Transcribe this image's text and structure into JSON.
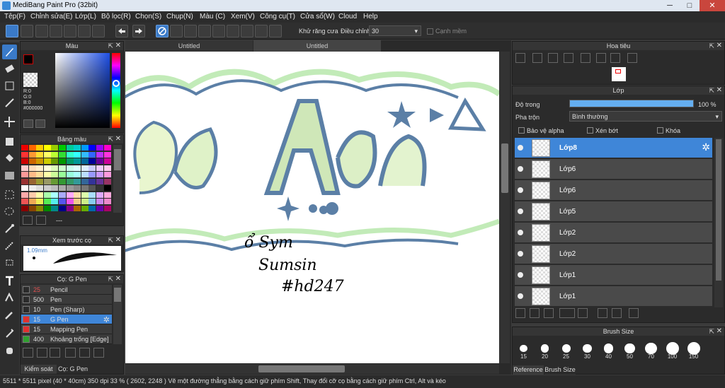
{
  "window": {
    "title": "MediBang Paint Pro (32bit)"
  },
  "menu": [
    "Tệp(F)",
    "Chỉnh sửa(E)",
    "Lớp(L)",
    "Bộ lọc(R)",
    "Chọn(S)",
    "Chụp(N)",
    "Màu (C)",
    "Xem(V)",
    "Công cụ(T)",
    "Cửa sổ(W)",
    "Cloud",
    "Help"
  ],
  "toolbar": {
    "antialias_label": "Khử răng cưa",
    "adjust_label": "Điều chỉnh",
    "adjust_value": "30",
    "edge_label": "Cạnh mềm"
  },
  "tabs": [
    "Untitled",
    "Untitled"
  ],
  "color_panel": {
    "title": "Màu",
    "r": "R:0",
    "g": "G:0",
    "b": "B:0",
    "hex": "#000000"
  },
  "palette_panel": {
    "title": "Bảng màu",
    "dashes": "---"
  },
  "preview_panel": {
    "title": "Xem trước cọ",
    "size": "1.09mm"
  },
  "brush_panel": {
    "title": "Cọ: G Pen",
    "items": [
      {
        "size": "25",
        "name": "Pencil",
        "color": "#2b2b2b",
        "selected": false
      },
      {
        "size": "500",
        "name": "Pen",
        "color": "#2b2b2b",
        "selected": false
      },
      {
        "size": "10",
        "name": "Pen (Sharp)",
        "color": "#2b2b2b",
        "selected": false
      },
      {
        "size": "15",
        "name": "G Pen",
        "color": "#e03030",
        "selected": true
      },
      {
        "size": "15",
        "name": "Mapping Pen",
        "color": "#e03030",
        "selected": false
      },
      {
        "size": "400",
        "name": "Khoảng trống [Edge]",
        "color": "#30a030",
        "selected": false
      }
    ],
    "bottom_tabs": [
      "Kiểm soát cọ",
      "Cọ: G Pen"
    ]
  },
  "navigator": {
    "title": "Hoa tiêu"
  },
  "layer_panel": {
    "title": "Lớp",
    "opacity_label": "Độ trong",
    "opacity_value": "100 %",
    "opacity": 1.0,
    "blend_label": "Pha trộn",
    "blend_value": "Bình thường",
    "protect_alpha": "Bảo vệ alpha",
    "clipping": "Xén bớt",
    "lock": "Khóa",
    "layers": [
      "Lớp8",
      "Lớp6",
      "Lớp6",
      "Lớp5",
      "Lớp2",
      "Lớp2",
      "Lớp1",
      "Lớp1"
    ]
  },
  "brush_size_panel": {
    "title": "Brush Size",
    "sizes": [
      "15",
      "20",
      "25",
      "30",
      "40",
      "50",
      "70",
      "100",
      "150"
    ],
    "tabs": [
      "Reference",
      "Brush Size"
    ]
  },
  "status": {
    "text": "5511 * 5511 pixel  (40 * 40cm)  350 dpi  33 %  ( 2602, 2248 )  Vẽ một đường thẳng bằng cách giữ phím Shift, Thay đổi cỡ cọ bằng cách giữ phím Ctrl, Alt và kéo"
  },
  "canvas": {
    "text_line1": "ổ Sym",
    "text_line2": "Sumsin",
    "text_line3": "#hd247"
  },
  "colors": {
    "accent": "#3f86d8",
    "panel": "#2b2b2b",
    "canvas": "#ffffff",
    "green": "#b8e6b0",
    "blue": "#5b7fa6"
  }
}
